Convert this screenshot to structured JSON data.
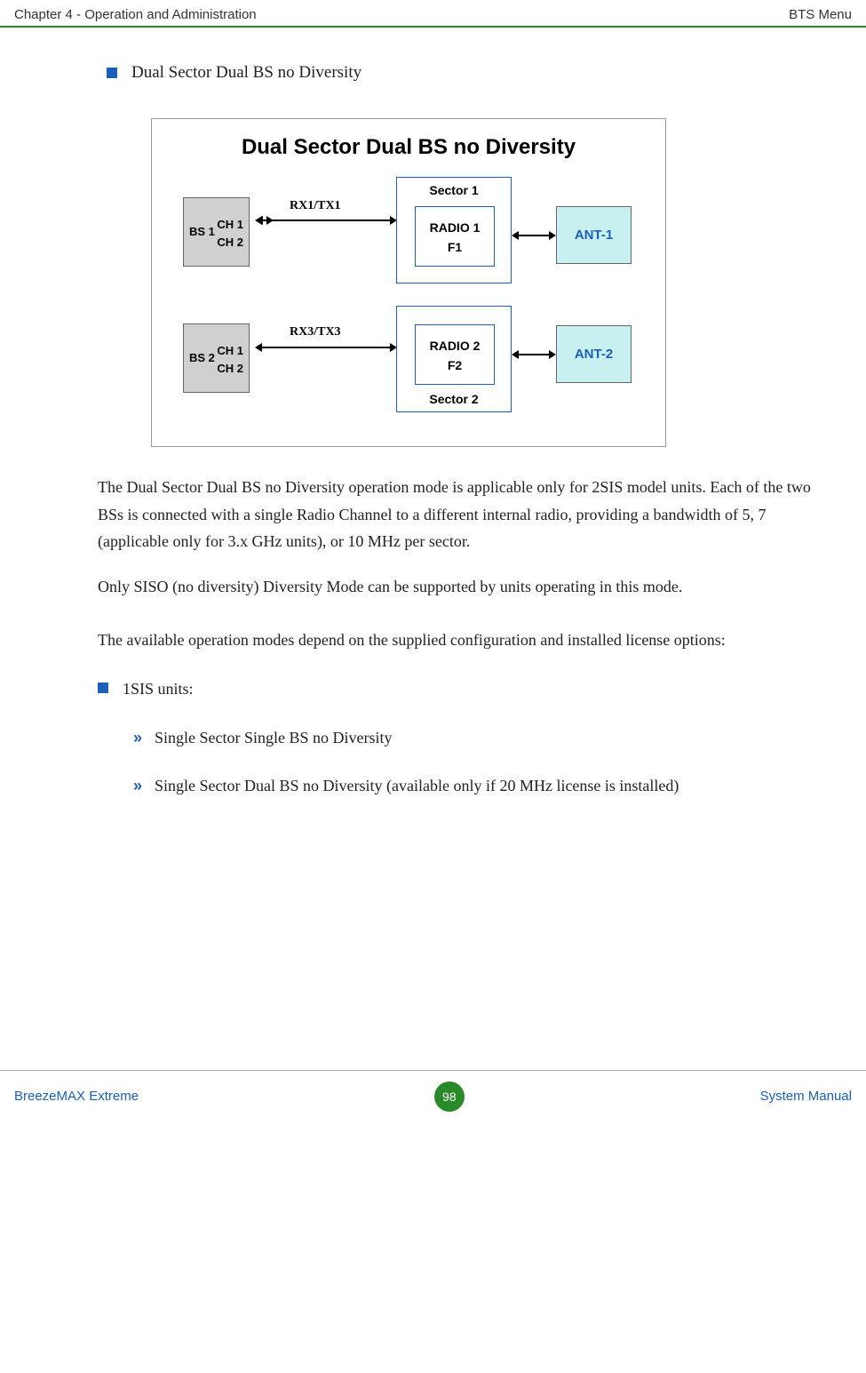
{
  "header": {
    "left": "Chapter 4 - Operation and Administration",
    "right": "BTS Menu"
  },
  "section": {
    "title": "Dual Sector Dual BS no Diversity"
  },
  "diagram": {
    "title": "Dual Sector Dual BS no Diversity",
    "bs1_label": "BS 1",
    "bs2_label": "BS 2",
    "ch1": "CH 1",
    "ch2": "CH 2",
    "rxtx1": "RX1/TX1",
    "rxtx3": "RX3/TX3",
    "sector1_label": "Sector 1",
    "sector2_label": "Sector 2",
    "radio1_line1": "RADIO 1",
    "radio1_line2": "F1",
    "radio2_line1": "RADIO 2",
    "radio2_line2": "F2",
    "ant1": "ANT-1",
    "ant2": "ANT-2"
  },
  "paragraphs": {
    "p1": "The Dual Sector Dual BS no Diversity operation mode is applicable only for 2SIS model units. Each of the two BSs is connected with a single Radio Channel to a different internal radio, providing a bandwidth of 5, 7 (applicable only for 3.x GHz units), or 10 MHz per sector.",
    "p2": "Only SISO (no diversity) Diversity Mode can be supported by units operating in this mode.",
    "p3": "The available operation modes depend on the supplied configuration and installed license options:"
  },
  "list": {
    "item1": "1SIS units:",
    "sub1": "Single Sector Single BS no Diversity",
    "sub2": "Single Sector Dual BS no Diversity (available only if 20 MHz license is installed)"
  },
  "footer": {
    "left": "BreezeMAX Extreme",
    "page": "98",
    "right": "System Manual"
  }
}
